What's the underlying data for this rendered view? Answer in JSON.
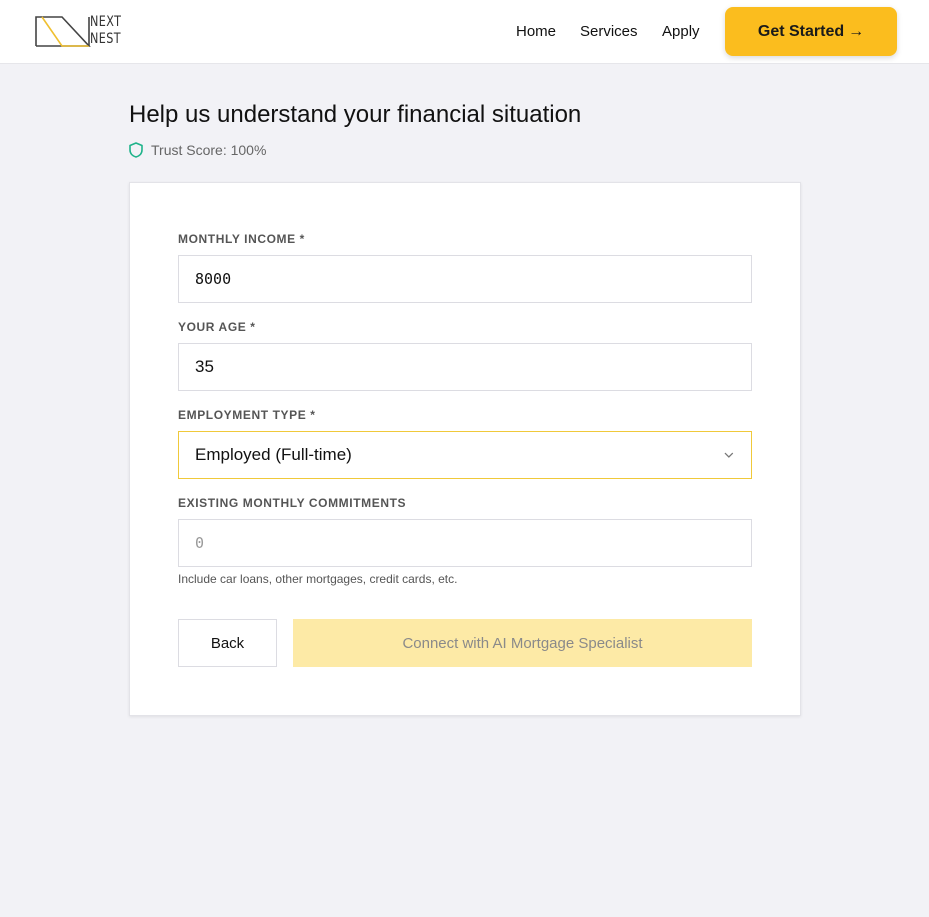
{
  "header": {
    "logo_line1": "NEXT",
    "logo_line2": "NEST",
    "nav": {
      "home": "Home",
      "services": "Services",
      "apply": "Apply"
    },
    "cta_label": "Get Started",
    "cta_arrow": "→"
  },
  "page": {
    "title": "Help us understand your financial situation",
    "trust_score": "Trust Score: 100%"
  },
  "form": {
    "monthly_income": {
      "label": "MONTHLY INCOME *",
      "value": "8000"
    },
    "age": {
      "label": "YOUR AGE *",
      "value": "35"
    },
    "employment_type": {
      "label": "EMPLOYMENT TYPE *",
      "selected": "Employed (Full-time)"
    },
    "commitments": {
      "label": "EXISTING MONTHLY COMMITMENTS",
      "placeholder": "0",
      "hint": "Include car loans, other mortgages, credit cards, etc."
    },
    "back_label": "Back",
    "submit_label": "Connect with AI Mortgage Specialist"
  },
  "colors": {
    "accent": "#fbbd1e",
    "disabled_button": "#fdeaa6",
    "trust_icon": "#1fb38a",
    "background": "#f2f2f6"
  },
  "icons": [
    "logo-mark",
    "arrow-right-icon",
    "shield-icon",
    "chevron-down-icon"
  ]
}
